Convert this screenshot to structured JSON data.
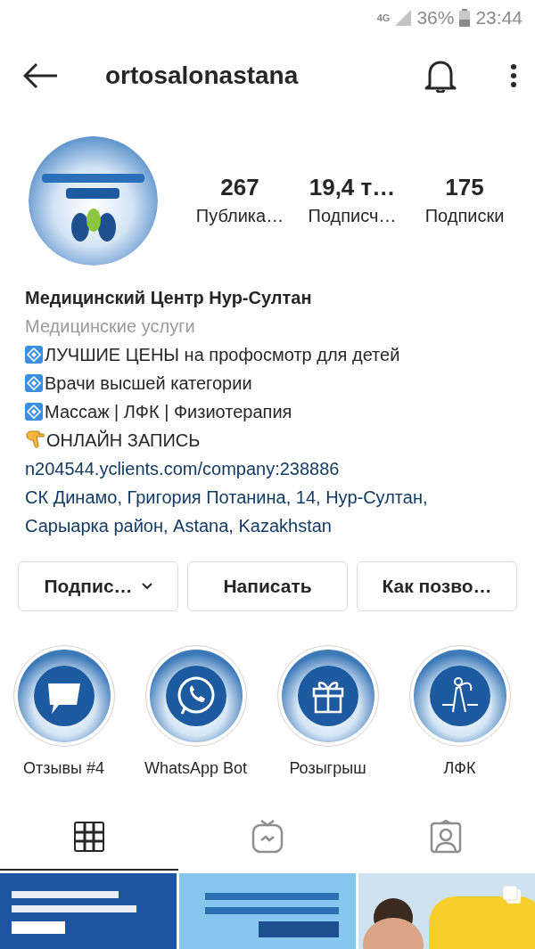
{
  "status_bar": {
    "network": "4G",
    "battery": "36%",
    "time": "23:44"
  },
  "header": {
    "username": "ortosalonastana"
  },
  "stats": [
    {
      "value": "267",
      "label": "Публика…"
    },
    {
      "value": "19,4 т…",
      "label": "Подписч…"
    },
    {
      "value": "175",
      "label": "Подписки"
    }
  ],
  "bio": {
    "name": "Медицинский Центр Нур-Султан",
    "category": "Медицинские услуги",
    "lines": [
      {
        "kind": "diamond",
        "text": "ЛУЧШИЕ ЦЕНЫ на профосмотр для детей"
      },
      {
        "kind": "diamond",
        "text": "Врачи высшей категории"
      },
      {
        "kind": "diamond",
        "text": "Массаж | ЛФК | Физиотерапия"
      },
      {
        "kind": "pointing",
        "text": "ОНЛАЙН ЗАПИСЬ"
      }
    ],
    "link": "n204544.yclients.com/company:238886",
    "address": "СК Динамо, Григория Потанина, 14, Нур-Султан, Сарыарка район, Astana, Kazakhstan"
  },
  "buttons": [
    {
      "label": "Подпис…",
      "dropdown": true
    },
    {
      "label": "Написать",
      "dropdown": false
    },
    {
      "label": "Как позво…",
      "dropdown": false
    }
  ],
  "highlights": [
    {
      "label": "Отзывы #4",
      "kind": "chat"
    },
    {
      "label": "WhatsApp Bot",
      "kind": "whatsapp"
    },
    {
      "label": "Розыгрыш",
      "kind": "gift"
    },
    {
      "label": "ЛФК",
      "kind": "exercise"
    }
  ],
  "tabs": [
    {
      "kind": "grid",
      "selected": true
    },
    {
      "kind": "tv",
      "selected": false
    },
    {
      "kind": "tagged",
      "selected": false
    }
  ],
  "posts": [
    {
      "multiple": false
    },
    {
      "multiple": false
    },
    {
      "multiple": true
    }
  ]
}
